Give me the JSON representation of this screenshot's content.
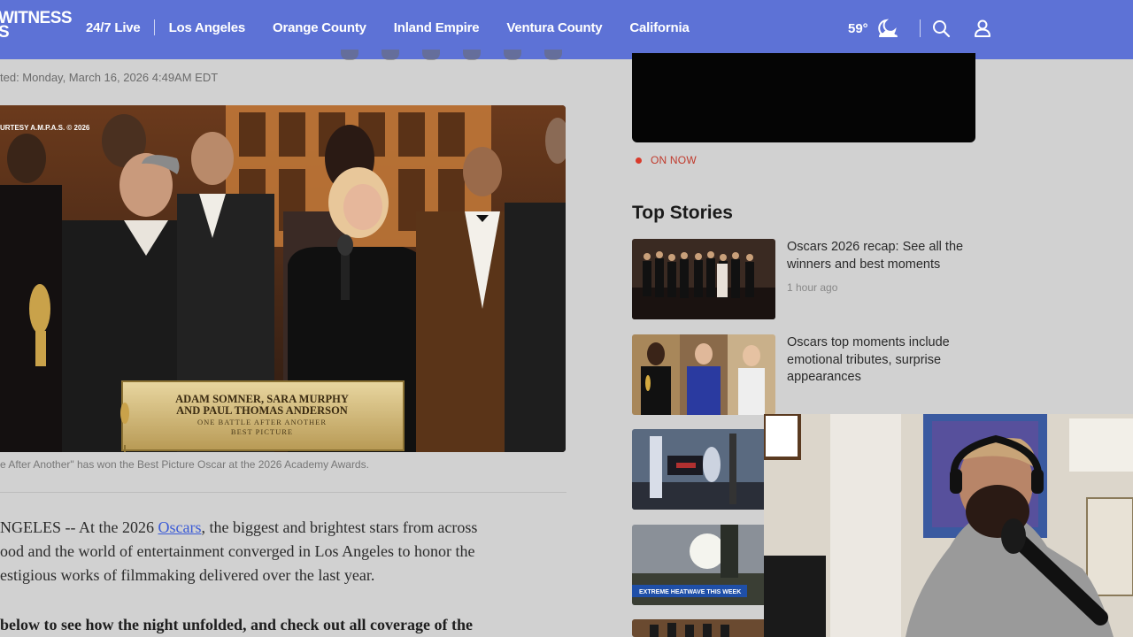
{
  "header": {
    "logo_line1": "WITNESS",
    "logo_line2": "S",
    "nav": {
      "live": "24/7 Live",
      "items": [
        "Los Angeles",
        "Orange County",
        "Inland Empire",
        "Ventura County",
        "California"
      ]
    },
    "weather": {
      "temp": "59°",
      "icon": "moon-cloud-icon"
    },
    "icons": [
      "search-icon",
      "user-icon"
    ],
    "brand_color": "#5d72d6"
  },
  "article": {
    "updated": "ted: Monday, March 16, 2026 4:49AM EDT",
    "image": {
      "courtesy": "URTESY A.M.P.A.S. © 2026",
      "plaque_line1": "ADAM SOMNER, SARA MURPHY",
      "plaque_line2": "AND PAUL THOMAS ANDERSON",
      "plaque_line3": "ONE BATTLE AFTER ANOTHER",
      "plaque_line4": "BEST PICTURE"
    },
    "caption": "e After Another\" has won the Best Picture Oscar at the 2026 Academy Awards.",
    "body_prefix": "NGELES -- At the 2026 ",
    "body_link": "Oscars",
    "body_rest_1": ", the biggest and brightest stars from across",
    "body_line2": "ood and the world of entertainment converged in Los Angeles to honor the",
    "body_line3": "estigious works of filmmaking delivered over the last year.",
    "body_bold": "below to see how the night unfolded, and check out all coverage of the"
  },
  "sidebar": {
    "on_now": "ON NOW",
    "top_stories_title": "Top Stories",
    "stories": [
      {
        "title": "Oscars 2026 recap: See all the winners and best moments",
        "time": "1 hour ago"
      },
      {
        "title": "Oscars top moments include emotional tributes, surprise appearances",
        "time": ""
      },
      {
        "title": "",
        "time": "",
        "banner": ""
      },
      {
        "title": "",
        "time": "",
        "banner": "EXTREME HEATWAVE THIS WEEK"
      },
      {
        "title": "",
        "time": ""
      }
    ]
  }
}
